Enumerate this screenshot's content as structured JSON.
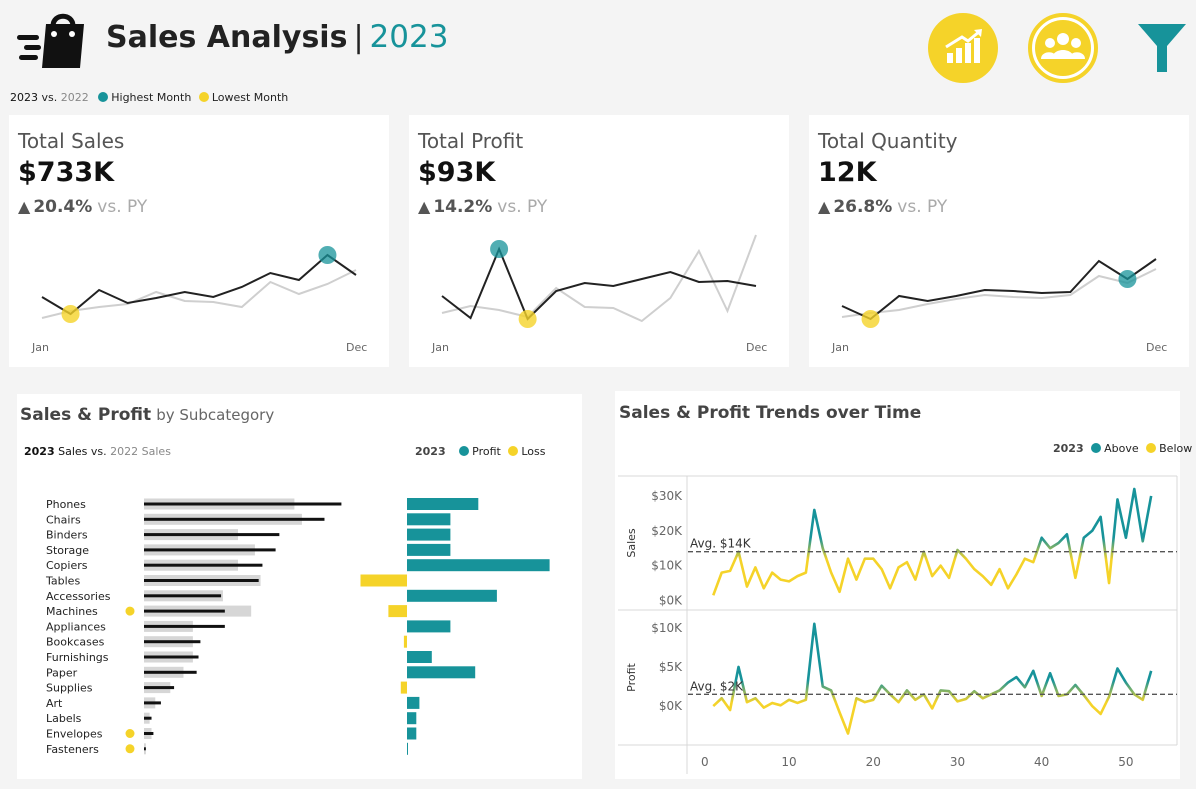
{
  "header": {
    "title": "Sales Analysis",
    "separator": "|",
    "year": "2023",
    "legend": {
      "year_cur": "2023",
      "vs": "vs.",
      "year_prev": "2022",
      "highest": "Highest Month",
      "lowest": "Lowest Month"
    },
    "icons": [
      "shopping-bag-icon",
      "growth-chart-icon",
      "people-group-icon",
      "filter-icon"
    ]
  },
  "colors": {
    "teal": "#17939a",
    "yellow": "#f5d329",
    "dark": "#222222",
    "grey": "#cccccc"
  },
  "kpis": [
    {
      "label": "Total Sales",
      "value": "$733K",
      "delta": "20.4%",
      "vs": "vs. PY",
      "start": "Jan",
      "end": "Dec",
      "chart_data": {
        "type": "line",
        "x": [
          "Jan",
          "Feb",
          "Mar",
          "Apr",
          "May",
          "Jun",
          "Jul",
          "Aug",
          "Sep",
          "Oct",
          "Nov",
          "Dec"
        ],
        "series": [
          {
            "values": [
              30,
              13,
              37,
              24,
              29,
              35,
              30,
              40,
              54,
              47,
              72,
              52
            ]
          },
          {
            "values": [
              9,
              16,
              20,
              23,
              35,
              26,
              25,
              20,
              45,
              33,
              43,
              57
            ]
          }
        ],
        "highest_index": 10,
        "lowest_index": 1
      }
    },
    {
      "label": "Total Profit",
      "value": "$93K",
      "delta": "14.2%",
      "vs": "vs. PY",
      "start": "Jan",
      "end": "Dec",
      "chart_data": {
        "type": "line",
        "x": [
          "Jan",
          "Feb",
          "Mar",
          "Apr",
          "May",
          "Jun",
          "Jul",
          "Aug",
          "Sep",
          "Oct",
          "Nov",
          "Dec"
        ],
        "series": [
          {
            "values": [
              31,
              9,
              78,
              8,
              36,
              44,
              41,
              48,
              55,
              45,
              46,
              41
            ]
          },
          {
            "values": [
              14,
              21,
              17,
              10,
              39,
              20,
              19,
              6,
              29,
              76,
              16,
              92
            ]
          }
        ],
        "highest_index": 2,
        "lowest_index": 3
      }
    },
    {
      "label": "Total Quantity",
      "value": "12K",
      "delta": "26.8%",
      "vs": "vs. PY",
      "start": "Jan",
      "end": "Dec",
      "chart_data": {
        "type": "line",
        "x": [
          "Jan",
          "Feb",
          "Mar",
          "Apr",
          "May",
          "Jun",
          "Jul",
          "Aug",
          "Sep",
          "Oct",
          "Nov",
          "Dec"
        ],
        "series": [
          {
            "values": [
              21,
              8,
              31,
              26,
              31,
              37,
              36,
              34,
              35,
              66,
              48,
              68
            ]
          },
          {
            "values": [
              10,
              14,
              17,
              23,
              28,
              32,
              30,
              29,
              32,
              51,
              44,
              58
            ]
          }
        ],
        "highest_index": 10,
        "lowest_index": 1
      }
    }
  ],
  "subcategory": {
    "title": "Sales & Profit",
    "subtitle": "by Subcategory",
    "legend_left": {
      "year_cur": "2023",
      "label_cur": "Sales",
      "vs": "vs.",
      "year_prev": "2022",
      "label_prev": "Sales"
    },
    "legend_right": {
      "year": "2023",
      "profit": "Profit",
      "loss": "Loss"
    },
    "chart_data": {
      "type": "bar",
      "categories": [
        "Phones",
        "Chairs",
        "Binders",
        "Storage",
        "Copiers",
        "Tables",
        "Accessories",
        "Machines",
        "Appliances",
        "Bookcases",
        "Furnishings",
        "Paper",
        "Supplies",
        "Art",
        "Labels",
        "Envelopes",
        "Fasteners"
      ],
      "sales_2023": [
        105,
        96,
        72,
        70,
        63,
        61,
        41,
        43,
        43,
        30,
        29,
        28,
        16,
        9,
        4,
        5,
        1
      ],
      "sales_2022": [
        80,
        84,
        50,
        59,
        50,
        62,
        42,
        57,
        26,
        26,
        26,
        21,
        14,
        6,
        3,
        4,
        1
      ],
      "profit_2023": [
        23,
        14,
        14,
        14,
        46,
        -15,
        29,
        -6,
        14,
        -1,
        8,
        22,
        -2,
        4,
        3,
        3,
        0.3
      ],
      "flagged": [
        false,
        false,
        false,
        false,
        false,
        false,
        false,
        true,
        false,
        false,
        false,
        false,
        false,
        false,
        false,
        true,
        true
      ]
    }
  },
  "trends": {
    "title": "Sales & Profit Trends over Time",
    "legend": {
      "year": "2023",
      "above": "Above",
      "below": "Below"
    },
    "chart_data": [
      {
        "type": "line",
        "ylabel": "Sales",
        "avg_label": "Avg. $14K",
        "avg": 14,
        "yticks": [
          "$0K",
          "$10K",
          "$20K",
          "$30K"
        ],
        "ytick_values": [
          0,
          10,
          20,
          30
        ],
        "ylim": [
          -1,
          34
        ],
        "xticks": [
          0,
          10,
          20,
          30,
          40,
          50
        ],
        "xlim": [
          -2,
          55
        ],
        "x": [
          1,
          2,
          3,
          4,
          5,
          6,
          7,
          8,
          9,
          10,
          11,
          12,
          13,
          14,
          15,
          16,
          17,
          18,
          19,
          20,
          21,
          22,
          23,
          24,
          25,
          26,
          27,
          28,
          29,
          30,
          31,
          32,
          33,
          34,
          35,
          36,
          37,
          38,
          39,
          40,
          41,
          42,
          43,
          44,
          45,
          46,
          47,
          48,
          49,
          50,
          51,
          52,
          53
        ],
        "values": [
          1.5,
          8,
          8.5,
          14,
          4,
          9.5,
          3.5,
          8,
          6,
          5.5,
          7,
          8,
          26,
          15,
          8,
          2.5,
          12,
          6,
          12,
          12,
          9,
          3.5,
          9.5,
          11,
          6,
          14,
          7,
          10,
          6.5,
          14.5,
          12,
          9,
          7,
          4.5,
          9,
          3.5,
          7.5,
          12,
          11,
          18,
          15,
          16.5,
          19,
          6.5,
          18,
          20,
          24,
          5,
          29,
          18,
          32,
          17,
          30,
          10,
          23,
          8.5
        ]
      },
      {
        "type": "line",
        "ylabel": "Profit",
        "avg_label": "Avg. $2K",
        "avg": 1.5,
        "yticks": [
          "$0K",
          "$5K",
          "$10K"
        ],
        "ytick_values": [
          0,
          5,
          10
        ],
        "ylim": [
          -4.2,
          11.5
        ],
        "xticks": [
          0,
          10,
          20,
          30,
          40,
          50
        ],
        "xlim": [
          -2,
          55
        ],
        "x": [
          1,
          2,
          3,
          4,
          5,
          6,
          7,
          8,
          9,
          10,
          11,
          12,
          13,
          14,
          15,
          16,
          17,
          18,
          19,
          20,
          21,
          22,
          23,
          24,
          25,
          26,
          27,
          28,
          29,
          30,
          31,
          32,
          33,
          34,
          35,
          36,
          37,
          38,
          39,
          40,
          41,
          42,
          43,
          44,
          45,
          46,
          47,
          48,
          49,
          50,
          51,
          52,
          53
        ],
        "values": [
          0,
          1,
          -0.5,
          5,
          0.5,
          1,
          -0.2,
          0.4,
          0.1,
          0.8,
          0.4,
          0.8,
          10.5,
          2.5,
          2,
          -0.8,
          -3.5,
          1,
          0.5,
          0.8,
          2.6,
          1.5,
          0.5,
          2,
          0.8,
          1.5,
          -0.3,
          2,
          1.9,
          0.6,
          0.9,
          1.9,
          1,
          1.5,
          2,
          3,
          3.7,
          2.4,
          4.5,
          1.3,
          4.2,
          1.3,
          1.5,
          2.7,
          1.4,
          0,
          -1,
          1.2,
          4.8,
          3,
          1.5,
          0.8,
          4.5,
          1
        ]
      }
    ]
  }
}
